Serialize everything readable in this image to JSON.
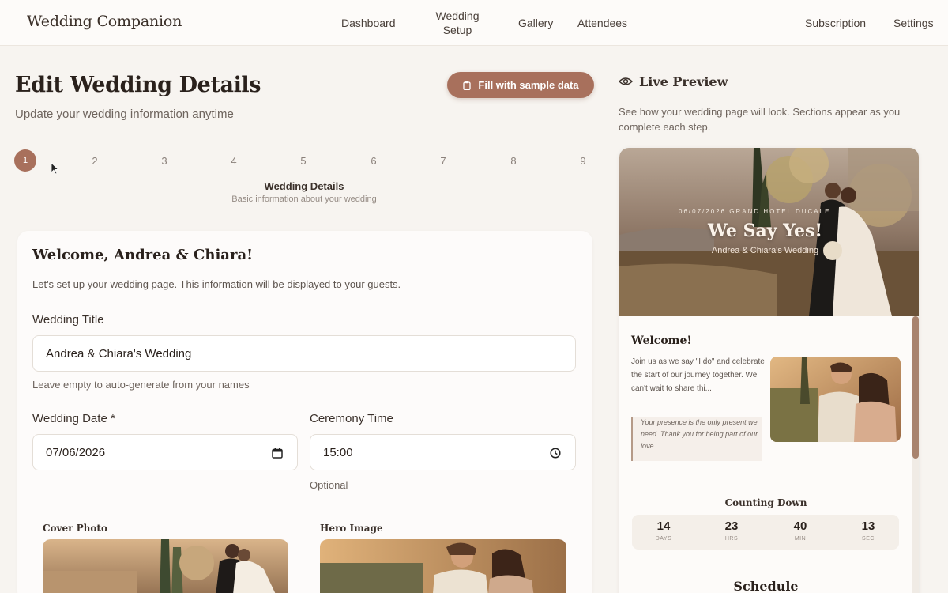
{
  "app": {
    "brand": "Wedding Companion"
  },
  "nav": {
    "dashboard": "Dashboard",
    "wedding_setup_1": "Wedding",
    "wedding_setup_2": "Setup",
    "gallery": "Gallery",
    "attendees": "Attendees",
    "subscription": "Subscription",
    "settings": "Settings"
  },
  "header": {
    "title": "Edit Wedding Details",
    "subtitle": "Update your wedding information anytime",
    "sample_button": "Fill with sample data"
  },
  "steps": {
    "items": [
      "1",
      "2",
      "3",
      "4",
      "5",
      "6",
      "7",
      "8",
      "9"
    ],
    "active": 1,
    "current_title": "Wedding Details",
    "current_desc": "Basic information about your wedding"
  },
  "form": {
    "welcome_title": "Welcome, Andrea & Chiara!",
    "welcome_text": "Let's set up your wedding page. This information will be displayed to your guests.",
    "title_label": "Wedding Title",
    "title_value": "Andrea & Chiara's Wedding",
    "title_hint": "Leave empty to auto-generate from your names",
    "date_label": "Wedding Date *",
    "date_value": "07/06/2026",
    "time_label": "Ceremony Time",
    "time_value": "15:00",
    "time_hint": "Optional",
    "cover_label": "Cover Photo",
    "hero_label": "Hero Image"
  },
  "preview": {
    "title": "Live Preview",
    "description": "See how your wedding page will look. Sections appear as you complete each step.",
    "hero_meta": "06/07/2026   GRAND HOTEL DUCALE",
    "hero_title": "We Say Yes!",
    "hero_sub": "Andrea & Chiara's Wedding",
    "welcome": "Welcome!",
    "body": "Join us as we say \"I do\" and celebrate the start of our journey together. We can't wait to share thi...",
    "quote": "Your presence is the only present we need. Thank you for being part of our love ...",
    "countdown_title": "Counting Down",
    "countdown": [
      {
        "value": "14",
        "unit": "DAYS"
      },
      {
        "value": "23",
        "unit": "HRS"
      },
      {
        "value": "40",
        "unit": "MIN"
      },
      {
        "value": "13",
        "unit": "SEC"
      }
    ],
    "schedule_title": "Schedule"
  },
  "colors": {
    "accent": "#a8705c",
    "background": "#f7f4f0",
    "card": "#fdfbfa"
  }
}
